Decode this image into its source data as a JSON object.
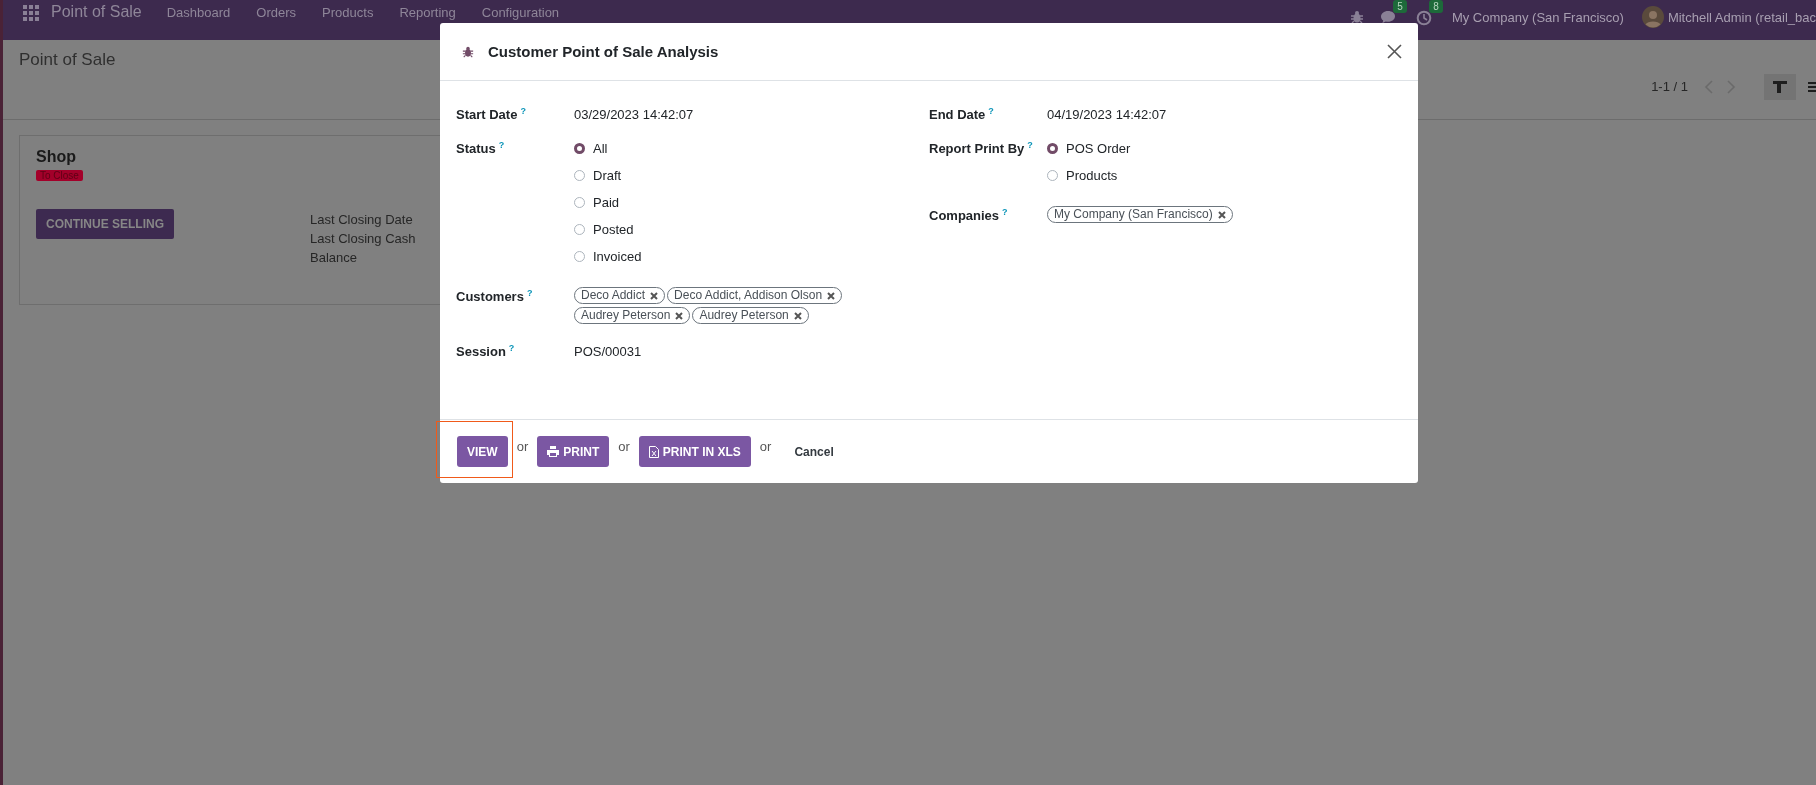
{
  "navbar": {
    "app_name": "Point of Sale",
    "menu": [
      "Dashboard",
      "Orders",
      "Products",
      "Reporting",
      "Configuration"
    ],
    "messages_count": "5",
    "activities_count": "8",
    "company": "My Company (San Francisco)",
    "user": "Mitchell Admin (retail_bac"
  },
  "page": {
    "breadcrumb": "Point of Sale",
    "pager": "1-1 / 1"
  },
  "card": {
    "title": "Shop",
    "badge": "To Close",
    "button": "CONTINUE SELLING",
    "info": [
      "Last Closing Date",
      "Last Closing Cash",
      "Balance"
    ]
  },
  "dialog": {
    "title": "Customer Point of Sale Analysis",
    "left": [
      {
        "kind": "text",
        "label": "Start Date",
        "help": "?",
        "value": "03/29/2023 14:42:07"
      },
      {
        "kind": "radio",
        "label": "Status",
        "help": "?",
        "options": [
          {
            "label": "All",
            "selected": true
          },
          {
            "label": "Draft",
            "selected": false
          },
          {
            "label": "Paid",
            "selected": false
          },
          {
            "label": "Posted",
            "selected": false
          },
          {
            "label": "Invoiced",
            "selected": false
          }
        ]
      },
      {
        "kind": "tags",
        "label": "Customers",
        "help": "?",
        "tags": [
          "Deco Addict",
          "Deco Addict, Addison Olson",
          "Audrey Peterson",
          "Audrey Peterson"
        ]
      },
      {
        "kind": "text",
        "label": "Session",
        "help": "?",
        "value": "POS/00031"
      }
    ],
    "right": [
      {
        "kind": "text",
        "label": "End Date",
        "help": "?",
        "value": "04/19/2023 14:42:07"
      },
      {
        "kind": "radio",
        "label": "Report Print By",
        "help": "?",
        "options": [
          {
            "label": "POS Order",
            "selected": true
          },
          {
            "label": "Products",
            "selected": false
          }
        ]
      },
      {
        "kind": "tags",
        "label": "Companies",
        "help": "?",
        "tags": [
          "My Company (San Francisco)"
        ]
      }
    ],
    "footer": [
      {
        "kind": "view",
        "label": "VIEW",
        "highlighted": true
      },
      {
        "kind": "separator",
        "label": "or"
      },
      {
        "kind": "print",
        "label": "PRINT",
        "highlighted": false
      },
      {
        "kind": "separator",
        "label": "or"
      },
      {
        "kind": "export",
        "label": "PRINT IN XLS",
        "highlighted": false
      },
      {
        "kind": "separator",
        "label": "or"
      },
      {
        "kind": "link",
        "label": "Cancel",
        "highlighted": false
      }
    ]
  }
}
